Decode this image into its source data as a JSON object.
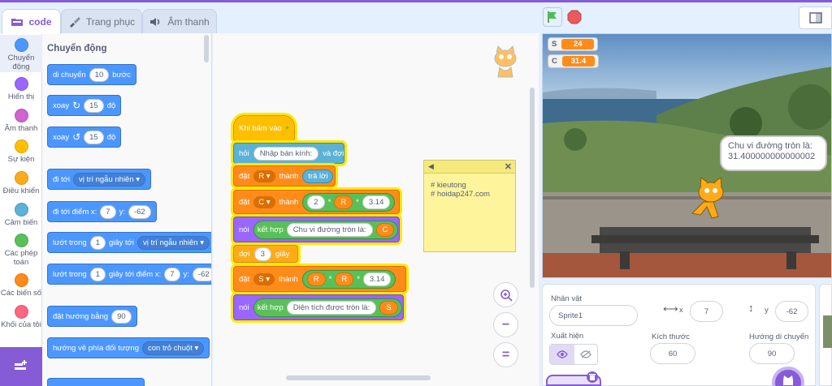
{
  "tabs": [
    {
      "label": "code"
    },
    {
      "label": "Trang phục"
    },
    {
      "label": "Âm thanh"
    }
  ],
  "categories": [
    {
      "label": "Chuyển động",
      "color": "#4c97ff"
    },
    {
      "label": "Hiển thị",
      "color": "#9966ff"
    },
    {
      "label": "Âm thanh",
      "color": "#cf63cf"
    },
    {
      "label": "Sự kiện",
      "color": "#ffbf00"
    },
    {
      "label": "Điều khiển",
      "color": "#ffab19"
    },
    {
      "label": "Cảm biến",
      "color": "#5cb1d6"
    },
    {
      "label": "Các phép toán",
      "color": "#59c059"
    },
    {
      "label": "Các biến số",
      "color": "#ff8c1a"
    },
    {
      "label": "Khối của tôi",
      "color": "#ff6680"
    }
  ],
  "palette": {
    "title": "Chuyển động",
    "move": {
      "a": "di chuyển",
      "v": "10",
      "b": "bước"
    },
    "turn_right": {
      "a": "xoay",
      "v": "15",
      "b": "độ"
    },
    "turn_left": {
      "a": "xoay",
      "v": "15",
      "b": "độ"
    },
    "goto": {
      "a": "đi tới",
      "d": "vị trí ngẫu nhiên"
    },
    "goto_xy": {
      "a": "đi tới điểm x:",
      "x": "7",
      "b": "y:",
      "y": "-62"
    },
    "glide": {
      "a": "lướt trong",
      "v": "1",
      "b": "giây tới",
      "d": "vị trí ngẫu nhiên"
    },
    "glide_xy": {
      "a": "lướt trong",
      "v": "1",
      "b": "giây tới điểm x:",
      "x": "7",
      "c": "y:",
      "y": "-62"
    },
    "point_dir": {
      "a": "đặt hướng bằng",
      "v": "90"
    },
    "point_towards": {
      "a": "hướng về phía đối tượng",
      "d": "con trỏ chuột"
    }
  },
  "script": {
    "hat": "Khi bấm vào",
    "ask": {
      "a": "hỏi",
      "v": "Nhập bán kính:",
      "b": "và đợi"
    },
    "set_r": {
      "a": "đặt",
      "var": "R",
      "b": "thành",
      "rep": "trả lời"
    },
    "set_c": {
      "a": "đặt",
      "var": "C",
      "b": "thành",
      "n1": "2",
      "m1": "*",
      "var2": "R",
      "m2": "*",
      "n2": "3.14"
    },
    "say_c": {
      "a": "nói",
      "j": "kết hợp",
      "v": "Chu vi đường tròn là:",
      "var": "C"
    },
    "wait": {
      "a": "đợi",
      "v": "3",
      "b": "giây"
    },
    "set_s": {
      "a": "đặt",
      "var": "S",
      "b": "thành",
      "v1": "R",
      "m1": "*",
      "v2": "R",
      "m2": "*",
      "n": "3.14"
    },
    "say_s": {
      "a": "nói",
      "j": "kết hợp",
      "v": "Diện tích được tròn là:",
      "var": "S"
    }
  },
  "note": {
    "line1": "# kieutong",
    "line2": "# hoidap247.com"
  },
  "zoom": {
    "minus_label": "−",
    "reset_label": "="
  },
  "stage": {
    "monitors": [
      {
        "name": "S",
        "value": "24"
      },
      {
        "name": "C",
        "value": "31.4"
      }
    ],
    "bubble_line1": "Chu vi đường tròn là:",
    "bubble_line2": "31.400000000000002"
  },
  "sprite_info": {
    "name_label": "Nhân vật",
    "name_value": "Sprite1",
    "x_label": "x",
    "x_value": "7",
    "y_label": "y",
    "y_value": "-62",
    "show_label": "Xuất hiện",
    "size_label": "Kích thước",
    "size_value": "60",
    "dir_label": "Hướng di chuyển",
    "dir_value": "90"
  }
}
